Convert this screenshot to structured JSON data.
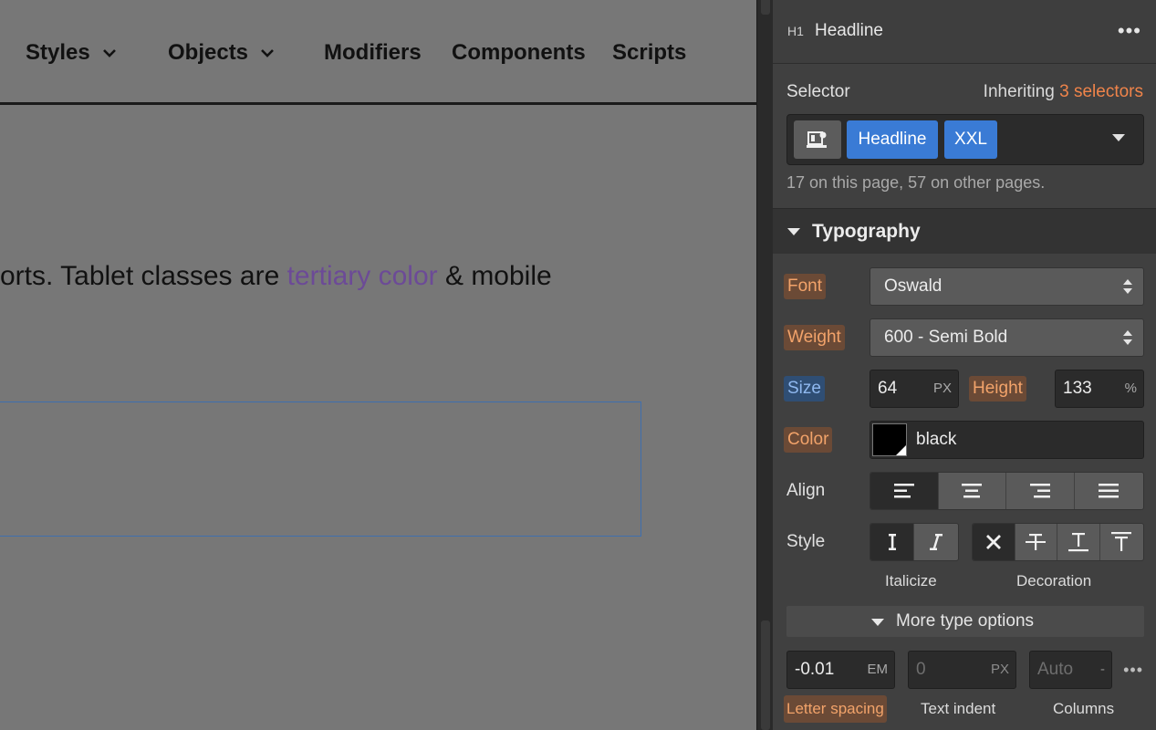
{
  "canvas": {
    "nav": {
      "styles_label": "Styles",
      "objects_label": "Objects",
      "modifiers_label": "Modifiers",
      "components_label": "Components",
      "scripts_label": "Scripts"
    },
    "body_text_before": "orts. Tablet classes are ",
    "body_text_accent": "tertiary color",
    "body_text_after": " & mobile"
  },
  "panel": {
    "element_badge": "H1",
    "element_name": "Headline",
    "selector_label": "Selector",
    "inheriting_prefix": "Inheriting ",
    "inheriting_count": "3 selectors",
    "chips": [
      "Headline",
      "XXL"
    ],
    "usage_note": "17 on this page, 57 on other pages.",
    "typography": {
      "section_title": "Typography",
      "font_label": "Font",
      "font_value": "Oswald",
      "weight_label": "Weight",
      "weight_value": "600 - Semi Bold",
      "size_label": "Size",
      "size_value": "64",
      "size_unit": "PX",
      "height_label": "Height",
      "height_value": "133",
      "height_unit": "%",
      "color_label": "Color",
      "color_value": "black",
      "align_label": "Align",
      "style_label": "Style",
      "italicize_label": "Italicize",
      "decoration_label": "Decoration",
      "more_options_label": "More type options",
      "letter_spacing_value": "-0.01",
      "letter_spacing_unit": "EM",
      "letter_spacing_label": "Letter spacing",
      "text_indent_value": "0",
      "text_indent_unit": "PX",
      "text_indent_label": "Text indent",
      "columns_value": "Auto",
      "columns_unit": "-",
      "columns_label": "Columns"
    }
  },
  "colors": {
    "canvas_bg": "#777777",
    "panel_bg": "#404040",
    "accent_blue": "#3a7bd5",
    "accent_orange": "#f0844a",
    "tertiary_text": "#6c4a97"
  }
}
